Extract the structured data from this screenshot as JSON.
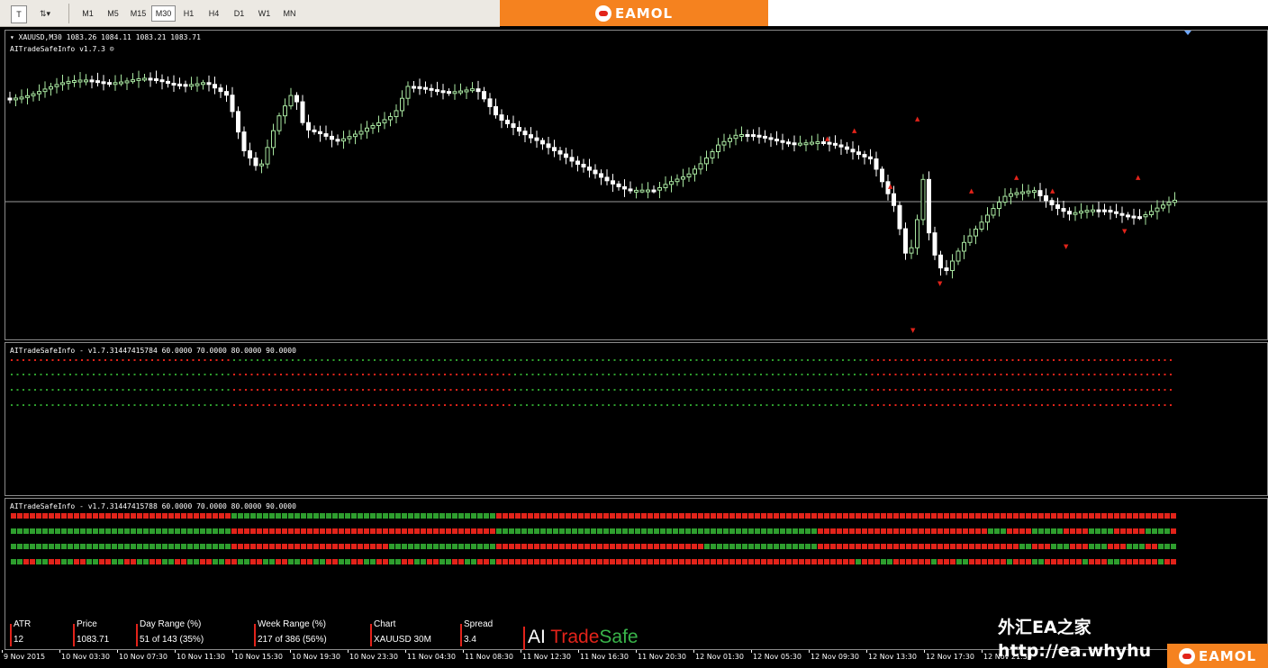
{
  "toolbar": {
    "icon_text": "T",
    "timeframes": [
      "M1",
      "M5",
      "M15",
      "M30",
      "H1",
      "H4",
      "D1",
      "W1",
      "MN"
    ],
    "active_timeframe": "M30"
  },
  "brand": {
    "name": "EAMOL",
    "color": "#f5821f"
  },
  "main_chart": {
    "symbol_line": "XAUUSD,M30  1083.26 1084.11 1083.21 1083.71",
    "indicator_line": "AITradeSafeInfo v1.7.3 ☺"
  },
  "indicator1": {
    "label": "AITradeSafeInfo - v1.7.31447415784 60.0000 70.0000 80.0000 90.0000"
  },
  "indicator2": {
    "label": "AITradeSafeInfo - v1.7.31447415788 60.0000 70.0000 80.0000 90.0000"
  },
  "info_panel": [
    {
      "label": "ATR",
      "value": "12"
    },
    {
      "label": "Price",
      "value": "1083.71"
    },
    {
      "label": "Day Range (%)",
      "value": "51 of 143 (35%)"
    },
    {
      "label": "Week Range (%)",
      "value": "217 of 386 (56%)"
    },
    {
      "label": "Chart",
      "value": "XAUUSD 30M"
    },
    {
      "label": "Spread",
      "value": "3.4"
    }
  ],
  "ai_brand": {
    "ai": "AI ",
    "trade": "Trade",
    "safe": "Safe"
  },
  "watermark": {
    "cn": "外汇EA之家",
    "url": "http://ea.whyhu"
  },
  "time_axis": [
    "9 Nov 2015",
    "10 Nov 03:30",
    "10 Nov 07:30",
    "10 Nov 11:30",
    "10 Nov 15:30",
    "10 Nov 19:30",
    "10 Nov 23:30",
    "11 Nov 04:30",
    "11 Nov 08:30",
    "11 Nov 12:30",
    "11 Nov 16:30",
    "11 Nov 20:30",
    "12 Nov 01:30",
    "12 Nov 05:30",
    "12 Nov 09:30",
    "12 Nov 13:30",
    "12 Nov 17:30",
    "12 Nov 21:30"
  ],
  "colors": {
    "bull": "#a8e6a0",
    "bear": "#ffffff",
    "up": "#2e9e2e",
    "down": "#e2231a",
    "hline": "#9a9a9a"
  }
}
